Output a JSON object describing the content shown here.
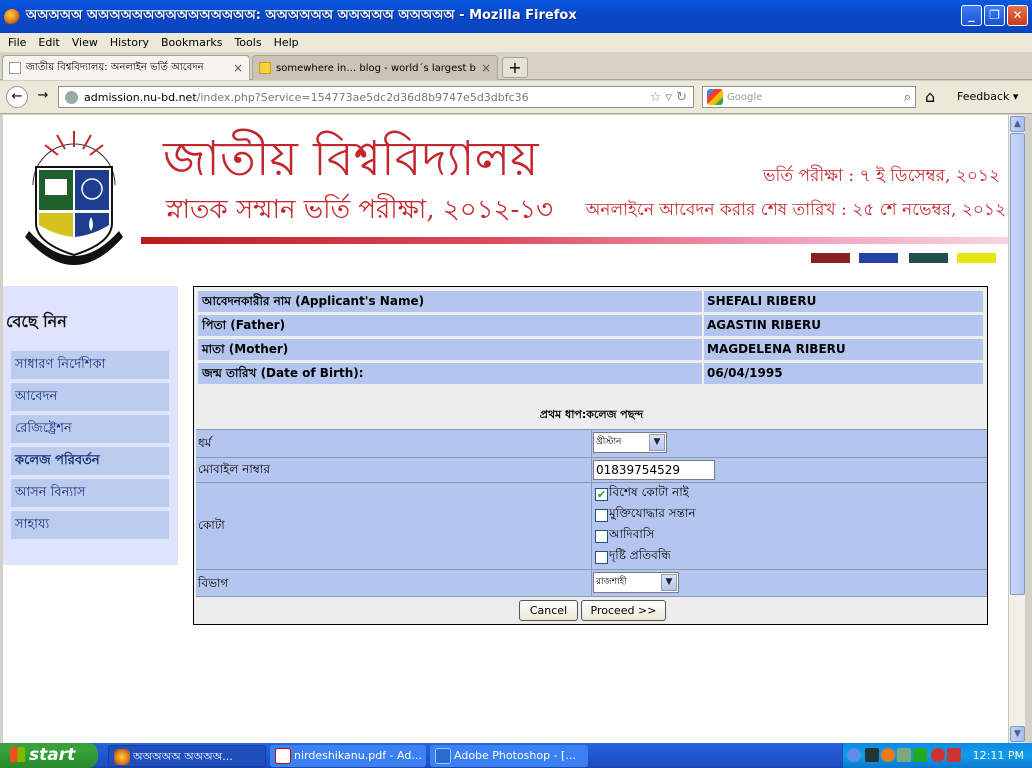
{
  "window": {
    "title": "অঅঅঅঅ অঅঅঅঅঅঅঅঅঅঅঅঅঅঅ: অঅঅঅঅঅ অঅঅঅঅ অঅঅঅঅ - Mozilla Firefox"
  },
  "menu": [
    "File",
    "Edit",
    "View",
    "History",
    "Bookmarks",
    "Tools",
    "Help"
  ],
  "tabs": [
    {
      "label": "জাতীয় বিশ্ববিদ্যালয়: অনলাইন ভর্তি আবেদন",
      "close": "×"
    },
    {
      "label": "somewhere in… blog - world´s largest b…",
      "close": "×"
    }
  ],
  "new_tab": "+",
  "nav": {
    "url_host": "admission.nu-bd.net",
    "url_path": "/index.php?Service=154773ae5dc2d36d8b9747e5d3dbfc36",
    "search_placeholder": "Google",
    "feedback": "Feedback"
  },
  "header": {
    "title": "জাতীয় বিশ্ববিদ্যালয়",
    "subtitle": "স্নাতক সম্মান ভর্তি পরীক্ষা, ২০১২-১৩",
    "exam_date": "ভর্তি পরীক্ষা :  ৭ ই  ডিসেম্বর, ২০১২",
    "deadline": "অনলাইনে আবেদন করার শেষ তারিখ : ২৫ শে নভেম্বর, ২০১২",
    "swatch_colors": [
      "#8b1f1f",
      "#2342a6",
      "#1f4e4e",
      "#e6e60a"
    ]
  },
  "sidebar": {
    "heading": "বেছে নিন",
    "items": [
      "সাধারণ নির্দেশিকা",
      "আবেদন",
      "রেজিষ্ট্রেশন",
      "কলেজ পরিবর্তন",
      "আসন বিন্যাস",
      "সাহায্য"
    ]
  },
  "applicant": {
    "rows": [
      {
        "label": "আবেদনকারীর নাম (Applicant's Name)",
        "value": "SHEFALI RIBERU"
      },
      {
        "label": "পিতা (Father)",
        "value": "AGASTIN RIBERU"
      },
      {
        "label": "মাতা (Mother)",
        "value": "MAGDELENA RIBERU"
      },
      {
        "label": "জন্ম তারিখ (Date of Birth):",
        "value": "06/04/1995"
      }
    ]
  },
  "form": {
    "step_title": "প্রথম ধাপ:কলেজ পছন্দ",
    "religion_label": "ধর্ম",
    "religion_value": "খ্রীস্টান",
    "mobile_label": "মোবাইল নাম্বার",
    "mobile_value": "01839754529",
    "quota_label": "কোটা",
    "quota_options": [
      {
        "label": "বিশেষ কোটা নাই",
        "checked": true
      },
      {
        "label": "মুক্তিযোদ্ধার সন্তান",
        "checked": false
      },
      {
        "label": "আদিবাসি",
        "checked": false
      },
      {
        "label": "দৃষ্টি প্রতিবন্ধি",
        "checked": false
      }
    ],
    "division_label": "বিভাগ",
    "division_value": "রাজশাহী",
    "cancel": "Cancel",
    "proceed": "Proceed >>"
  },
  "taskbar": {
    "start": "start",
    "tasks": [
      "অঅঅঅঅ অঅঅঅ...",
      "nirdeshikanu.pdf - Ad...",
      "Adobe Photoshop - [..."
    ],
    "clock": "12:11 PM"
  }
}
